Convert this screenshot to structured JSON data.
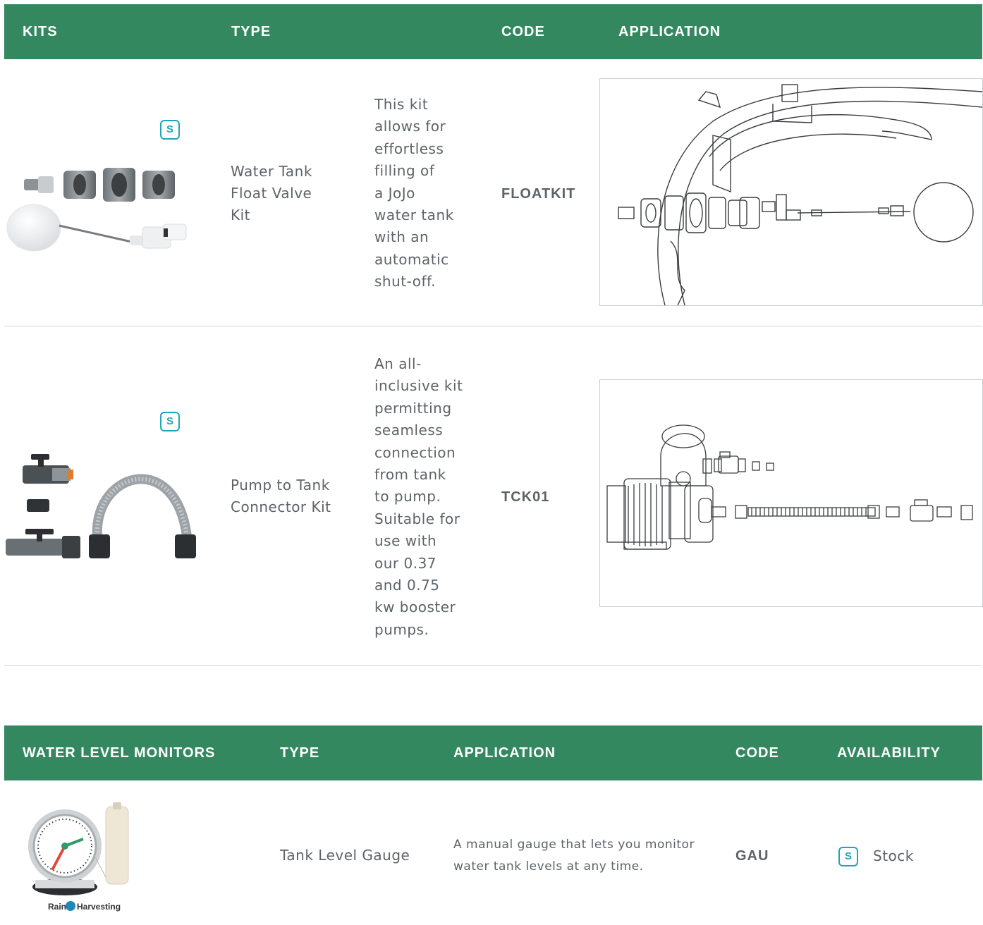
{
  "kits_table": {
    "headers": {
      "kits": "KITS",
      "type": "TYPE",
      "code": "CODE",
      "application": "APPLICATION"
    },
    "rows": [
      {
        "badge": "S",
        "type_lines": [
          "Water Tank",
          "Float Valve",
          "Kit"
        ],
        "description_lines": [
          "This kit",
          "allows for",
          "effortless",
          "filling of",
          "a JoJo",
          "water tank",
          "with an",
          "automatic",
          "shut-off."
        ],
        "code": "FLOATKIT",
        "product_image": "float-valve-kit-parts",
        "application_image": "float-valve-installation-diagram"
      },
      {
        "badge": "S",
        "type_lines": [
          "Pump to Tank",
          "Connector Kit"
        ],
        "description_lines": [
          "An all-",
          "inclusive kit",
          "permitting",
          "seamless",
          "connection",
          "from tank",
          "to pump.",
          "Suitable for",
          "use with",
          "our 0.37",
          "and 0.75",
          "kw booster",
          "pumps."
        ],
        "code": "TCK01",
        "product_image": "pump-connector-kit-parts",
        "application_image": "pump-connector-installation-diagram"
      }
    ]
  },
  "monitors_table": {
    "headers": {
      "monitors": "WATER LEVEL MONITORS",
      "type": "TYPE",
      "application": "APPLICATION",
      "code": "CODE",
      "availability": "AVAILABILITY"
    },
    "rows": [
      {
        "type": "Tank Level Gauge",
        "application_lines": [
          "A manual gauge that lets you monitor",
          "water tank levels at any time."
        ],
        "code": "GAU",
        "badge": "S",
        "availability": "Stock",
        "product_image": "tank-level-gauge",
        "logo_text": "Rain Harvesting"
      }
    ]
  },
  "colors": {
    "header_bg": "#338860",
    "badge": "#1fa6b6",
    "text": "#5d6368",
    "divider": "#cfd3d6"
  }
}
